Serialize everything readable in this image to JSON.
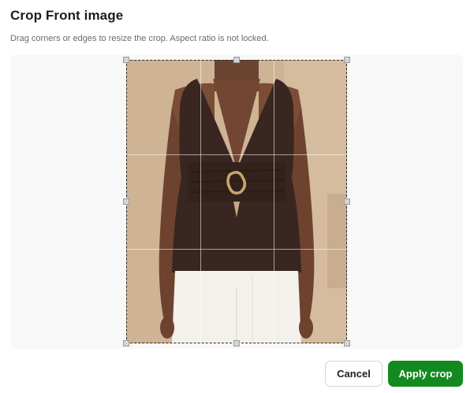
{
  "dialog": {
    "title": "Crop Front image",
    "subtitle": "Drag corners or edges to resize the crop. Aspect ratio is not locked."
  },
  "buttons": {
    "cancel_label": "Cancel",
    "apply_label": "Apply crop"
  },
  "colors": {
    "apply_bg": "#138a1f",
    "stage_bg": "#f8f8f8",
    "top_color": "#3a2620",
    "pants_color": "#f4f1ec"
  },
  "icons": {
    "handle": "resize-handle-icon"
  }
}
